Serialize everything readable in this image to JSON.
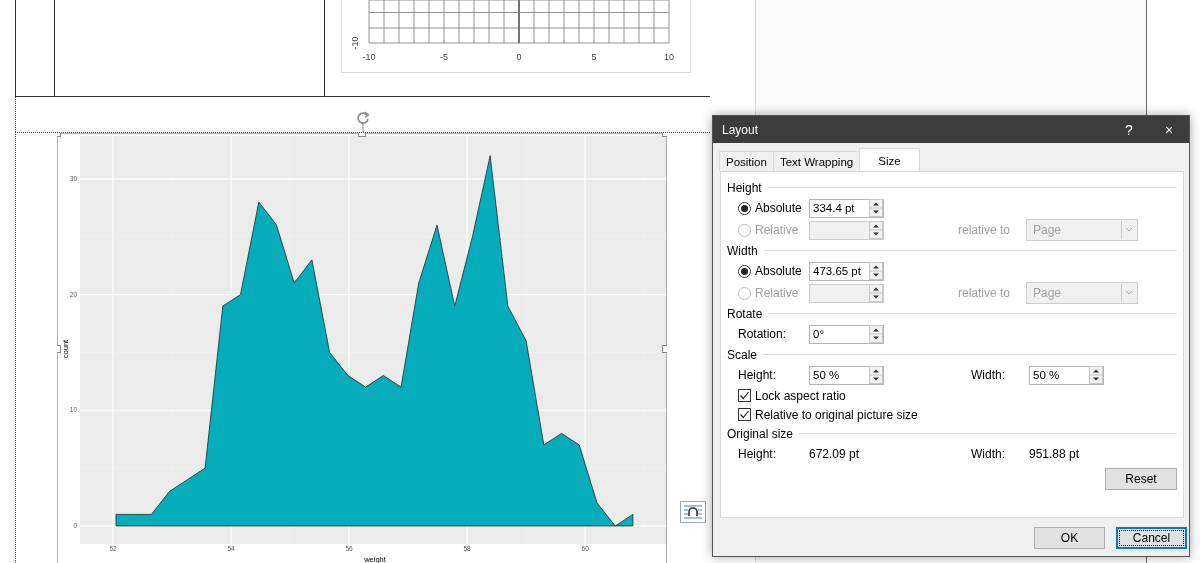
{
  "document": {
    "top_chart": {
      "x_labels": [
        "-10",
        "-5",
        "0",
        "5",
        "10"
      ],
      "y_label": "-10"
    },
    "picture": {
      "chart_data": {
        "type": "area",
        "grid": true,
        "xlabel": "weight",
        "ylabel": "count",
        "xlim": [
          51.44,
          61.37
        ],
        "ylim": [
          -1.56,
          33.7
        ],
        "xticks": [
          52,
          54,
          56,
          58,
          60
        ],
        "yticks": [
          0,
          10,
          20,
          30
        ],
        "x": [
          52.05,
          52.35,
          52.65,
          52.96,
          53.26,
          53.56,
          53.86,
          54.16,
          54.47,
          54.77,
          55.07,
          55.37,
          55.67,
          55.98,
          56.28,
          56.58,
          56.88,
          57.18,
          57.49,
          57.79,
          58.09,
          58.39,
          58.69,
          59.0,
          59.3,
          59.6,
          59.9,
          60.2,
          60.51,
          60.81
        ],
        "series": [
          {
            "color": "#05adbb",
            "values": [
              1,
              1,
              1,
              3,
              4,
              5,
              19,
              20,
              28,
              26,
              21,
              23,
              15,
              13,
              12,
              13,
              12,
              21,
              26,
              19,
              25,
              32,
              19,
              16,
              7,
              8,
              7,
              2,
              0,
              1
            ]
          }
        ]
      }
    }
  },
  "dialog": {
    "title": "Layout",
    "help": "?",
    "close": "×",
    "tabs": [
      {
        "label": "Position",
        "selected": false
      },
      {
        "label": "Text Wrapping",
        "selected": false
      },
      {
        "label": "Size",
        "selected": true
      }
    ],
    "sections": [
      {
        "title": "Height",
        "rows": [
          {
            "kind": "radio",
            "label": "Absolute",
            "selected": true,
            "disabled": false,
            "value": "334.4 pt"
          },
          {
            "kind": "radio",
            "label": "Relative",
            "selected": false,
            "disabled": true,
            "relative_label": "relative to",
            "relative_value": "Page"
          }
        ]
      },
      {
        "title": "Width",
        "rows": [
          {
            "kind": "radio",
            "label": "Absolute",
            "selected": true,
            "disabled": false,
            "value": "473.65 pt"
          },
          {
            "kind": "radio",
            "label": "Relative",
            "selected": false,
            "disabled": true,
            "relative_label": "relative to",
            "relative_value": "Page"
          }
        ]
      },
      {
        "title": "Rotate",
        "rows": [
          {
            "kind": "spin",
            "label": "Rotation:",
            "value": "0°"
          }
        ]
      },
      {
        "title": "Scale",
        "rows": [
          {
            "kind": "spin_pair",
            "label": "Height:",
            "value": "50 %",
            "label2": "Width:",
            "value2": "50 %"
          },
          {
            "kind": "checkbox",
            "label": "Lock aspect ratio",
            "checked": true
          },
          {
            "kind": "checkbox",
            "label": "Relative to original picture size",
            "checked": true
          }
        ]
      },
      {
        "title": "Original size",
        "rows": [
          {
            "kind": "info_pair",
            "label": "Height:",
            "value": "672.09 pt",
            "label2": "Width:",
            "value2": "951.88 pt"
          },
          {
            "kind": "button",
            "label": "Reset"
          }
        ]
      }
    ],
    "buttons": [
      {
        "label": "OK",
        "focused": false
      },
      {
        "label": "Cancel",
        "focused": true
      }
    ]
  }
}
